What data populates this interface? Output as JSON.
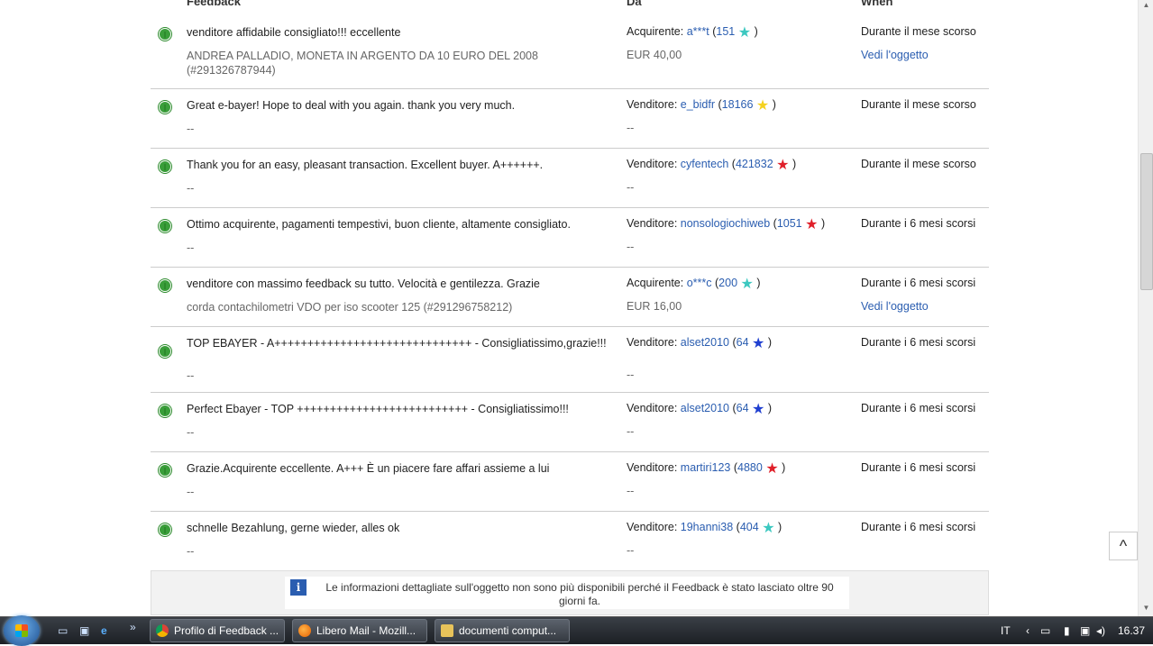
{
  "table": {
    "headers": {
      "feedback": "Feedback",
      "from": "Da",
      "when": "When"
    },
    "rows": [
      {
        "comment": "venditore affidabile consigliato!!! eccellente",
        "item": "ANDREA PALLADIO, MONETA IN ARGENTO DA 10 EURO DEL 2008 (#291326787944)",
        "role": "Acquirente:",
        "user": "a***t",
        "score": "151",
        "star": "turquoise",
        "price": "EUR 40,00",
        "when": "Durante il mese scorso",
        "link": "Vedi l'oggetto"
      },
      {
        "comment": "Great e-bayer! Hope to deal with you again. thank you very much.",
        "item": "--",
        "role": "Venditore:",
        "user": "e_bidfr",
        "score": "18166",
        "star": "yellow-shooting",
        "price": "--",
        "when": "Durante il mese scorso",
        "link": ""
      },
      {
        "comment": "Thank you for an easy, pleasant transaction. Excellent buyer. A++++++.",
        "item": "--",
        "role": "Venditore:",
        "user": "cyfentech",
        "score": "421832",
        "star": "red-shooting",
        "price": "--",
        "when": "Durante il mese scorso",
        "link": ""
      },
      {
        "comment": "Ottimo acquirente, pagamenti tempestivi, buon cliente, altamente consigliato.",
        "item": "--",
        "role": "Venditore:",
        "user": "nonsologiochiweb",
        "score": "1051",
        "star": "red",
        "price": "--",
        "when": "Durante i 6 mesi scorsi",
        "link": ""
      },
      {
        "comment": "venditore con massimo feedback su tutto. Velocità e gentilezza. Grazie",
        "item": "corda contachilometri VDO per iso scooter 125 (#291296758212)",
        "role": "Acquirente:",
        "user": "o***c",
        "score": "200",
        "star": "turquoise",
        "price": "EUR 16,00",
        "when": "Durante i 6 mesi scorsi",
        "link": "Vedi l'oggetto"
      },
      {
        "comment": "TOP EBAYER - A++++++++++++++++++++++++++++++ - Consigliatissimo,grazie!!!",
        "item": "--",
        "role": "Venditore:",
        "user": "alset2010",
        "score": "64",
        "star": "blue",
        "price": "--",
        "when": "Durante i 6 mesi scorsi",
        "link": ""
      },
      {
        "comment": "Perfect Ebayer - TOP ++++++++++++++++++++++++++ - Consigliatissimo!!!",
        "item": "--",
        "role": "Venditore:",
        "user": "alset2010",
        "score": "64",
        "star": "blue",
        "price": "--",
        "when": "Durante i 6 mesi scorsi",
        "link": ""
      },
      {
        "comment": "Grazie.Acquirente eccellente. A+++ È un piacere fare affari assieme a lui",
        "item": "--",
        "role": "Venditore:",
        "user": "martiri123",
        "score": "4880",
        "star": "red",
        "price": "--",
        "when": "Durante i 6 mesi scorsi",
        "link": ""
      },
      {
        "comment": "schnelle Bezahlung, gerne wieder, alles ok",
        "item": "--",
        "role": "Venditore:",
        "user": "19hanni38",
        "score": "404",
        "star": "turquoise",
        "price": "--",
        "when": "Durante i 6 mesi scorsi",
        "link": ""
      }
    ]
  },
  "notice": {
    "icon": "i",
    "text": "Le informazioni dettagliate sull'oggetto non sono più disponibili perché il Feedback è stato lasciato oltre 90 giorni fa."
  },
  "colors": {
    "turquoise": "#3cc8c0",
    "yellow-shooting": "#f5d21f",
    "red-shooting": "#e0202a",
    "red": "#e0202a",
    "blue": "#1f3fd0",
    "link": "#2a5db0"
  },
  "back_to_top": "^",
  "taskbar": {
    "tasks": [
      {
        "label": "Profilo di Feedback ...",
        "icon": "chrome-icon"
      },
      {
        "label": "Libero Mail - Mozill...",
        "icon": "firefox-icon"
      },
      {
        "label": "documenti comput...",
        "icon": "folder-icon"
      }
    ],
    "lang": "IT",
    "clock": "16.37",
    "more": "»"
  }
}
